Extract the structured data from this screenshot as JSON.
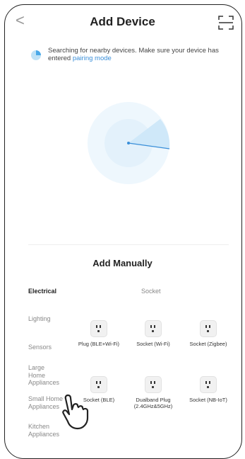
{
  "header": {
    "back_label": "<",
    "title": "Add Device",
    "scan_icon": "scan-icon"
  },
  "search": {
    "text": "Searching for nearby devices. Make sure your device has entered",
    "link": "pairing mode"
  },
  "manual": {
    "title": "Add Manually",
    "section": "Socket"
  },
  "categories": [
    {
      "label": "Electrical",
      "active": true
    },
    {
      "label": "Lighting",
      "active": false
    },
    {
      "label": "Sensors",
      "active": false
    },
    {
      "label": "Large Home Appliances",
      "active": false
    },
    {
      "label": "Small Home Appliances",
      "active": false
    },
    {
      "label": "Kitchen Appliances",
      "active": false
    }
  ],
  "devices": [
    {
      "label": "Plug (BLE+Wi-Fi)"
    },
    {
      "label": "Socket (Wi-Fi)"
    },
    {
      "label": "Socket (Zigbee)"
    },
    {
      "label": "Socket (BLE)"
    },
    {
      "label": "Dualband Plug (2.4GHz&5GHz)"
    },
    {
      "label": "Socket (NB-IoT)"
    }
  ],
  "colors": {
    "accent": "#3a8fd9",
    "radar": "#d6ecfa"
  }
}
